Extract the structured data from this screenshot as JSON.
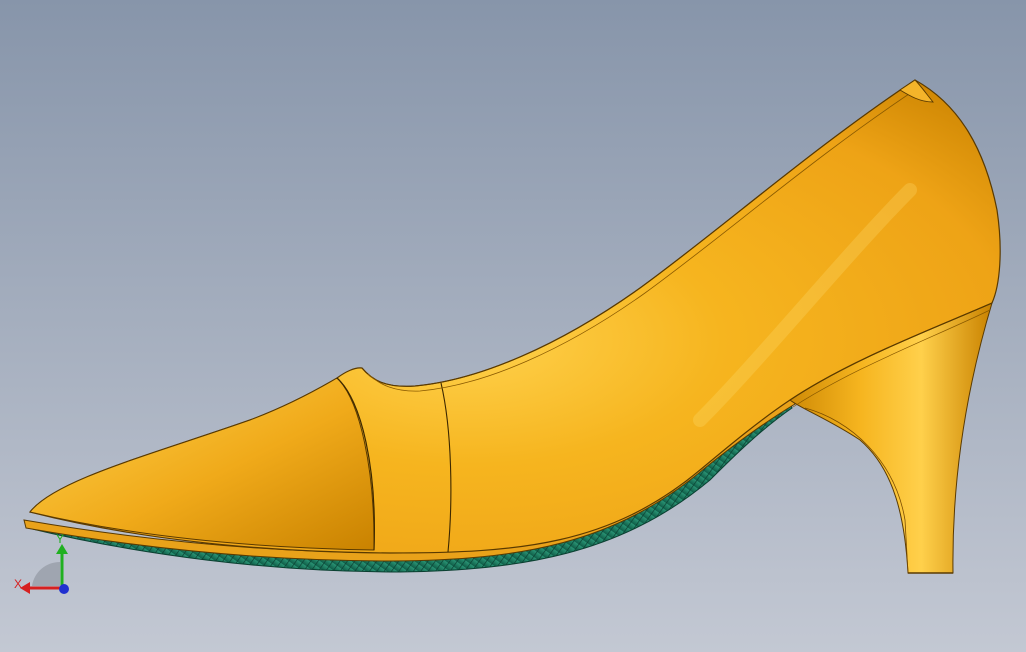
{
  "viewport": {
    "background_top": "#8795aa",
    "background_bottom": "#c3c8d3"
  },
  "model": {
    "upper_color": "#f2a81a",
    "highlight_color": "#ffd24d",
    "shadow_color": "#c98200",
    "edge_color": "#5a3a00",
    "sole_color": "#1f7f62",
    "sole_dark": "#0f5d47"
  },
  "triad": {
    "x_label": "X",
    "y_label": "Y",
    "x_color": "#d62020",
    "y_color": "#20b020",
    "z_color": "#2030d0"
  }
}
